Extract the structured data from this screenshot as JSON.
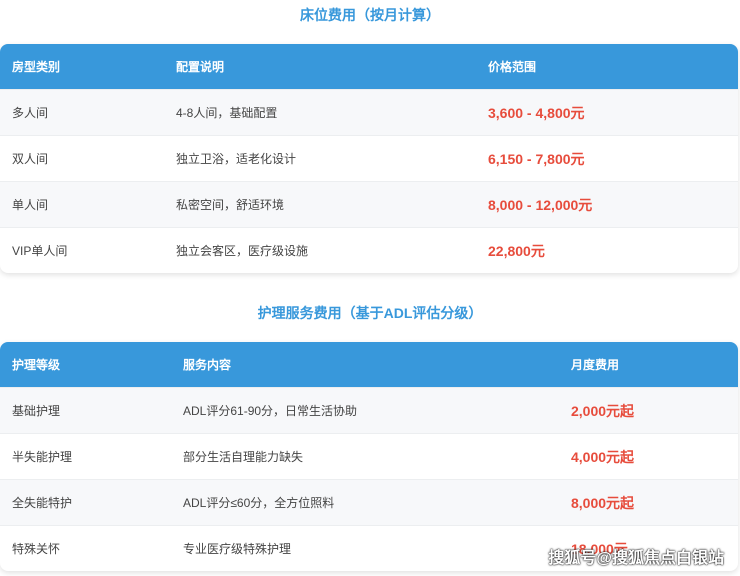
{
  "bed": {
    "title": "床位费用（按月计算）",
    "headers": [
      "房型类别",
      "配置说明",
      "价格范围"
    ],
    "rows": [
      [
        "多人间",
        "4-8人间，基础配置",
        "3,600 - 4,800元"
      ],
      [
        "双人间",
        "独立卫浴，适老化设计",
        "6,150 - 7,800元"
      ],
      [
        "单人间",
        "私密空间，舒适环境",
        "8,000 - 12,000元"
      ],
      [
        "VIP单人间",
        "独立会客区，医疗级设施",
        "22,800元"
      ]
    ]
  },
  "care": {
    "title": "护理服务费用（基于ADL评估分级）",
    "headers": [
      "护理等级",
      "服务内容",
      "月度费用"
    ],
    "rows": [
      [
        "基础护理",
        "ADL评分61-90分，日常生活协助",
        "2,000元起"
      ],
      [
        "半失能护理",
        "部分生活自理能力缺失",
        "4,000元起"
      ],
      [
        "全失能特护",
        "ADL评分≤60分，全方位照料",
        "8,000元起"
      ],
      [
        "特殊关怀",
        "专业医疗级特殊护理",
        "18,000元"
      ]
    ]
  },
  "watermark": "搜狐号@搜狐焦点白银站"
}
